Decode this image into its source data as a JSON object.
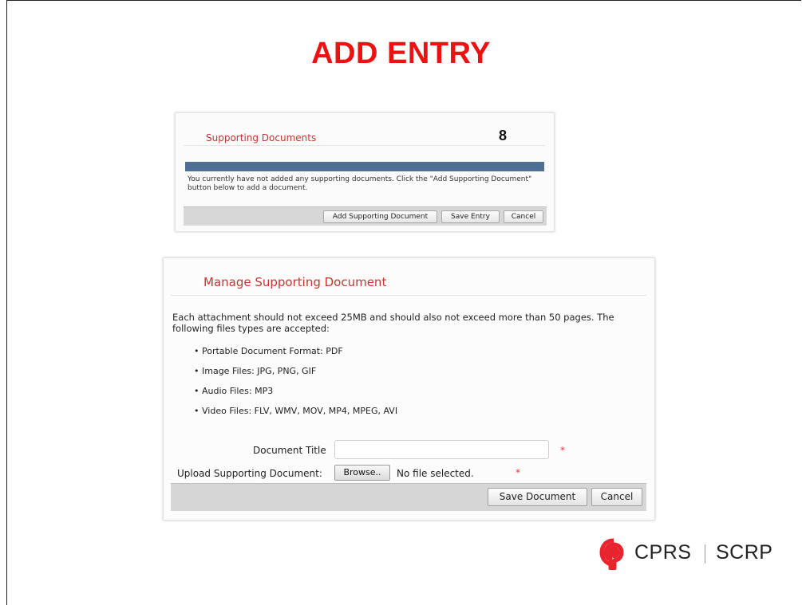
{
  "slide": {
    "title": "ADD ENTRY"
  },
  "supporting_panel": {
    "title": "Supporting Documents",
    "step_number": "8",
    "message": "You currently have not added any supporting documents. Click the \"Add Supporting Document\" button below to add a document.",
    "buttons": {
      "add": "Add Supporting Document",
      "save": "Save Entry",
      "cancel": "Cancel"
    }
  },
  "manage_panel": {
    "title": "Manage Supporting Document",
    "intro": "Each attachment should not exceed 25MB and should also not exceed more than 50 pages. The following files types are accepted:",
    "file_types": [
      "Portable Document Format: PDF",
      "Image Files: JPG, PNG, GIF",
      "Audio Files: MP3",
      "Video Files: FLV, WMV, MOV, MP4, MPEG, AVI"
    ],
    "bullet": "•",
    "document_title_label": "Document Title",
    "document_title_value": "",
    "upload_label": "Upload Supporting Document:",
    "browse_label": "Browse..",
    "file_status": "No file selected.",
    "required_marker": "*",
    "buttons": {
      "save": "Save Document",
      "cancel": "Cancel"
    }
  },
  "logo": {
    "text_en": "CPRS",
    "text_fr": "SCRP",
    "color": "#e8252f"
  },
  "colors": {
    "title_red": "#ee1111",
    "panel_title_red": "#c8352f",
    "progress_bar": "#4f6f96"
  }
}
